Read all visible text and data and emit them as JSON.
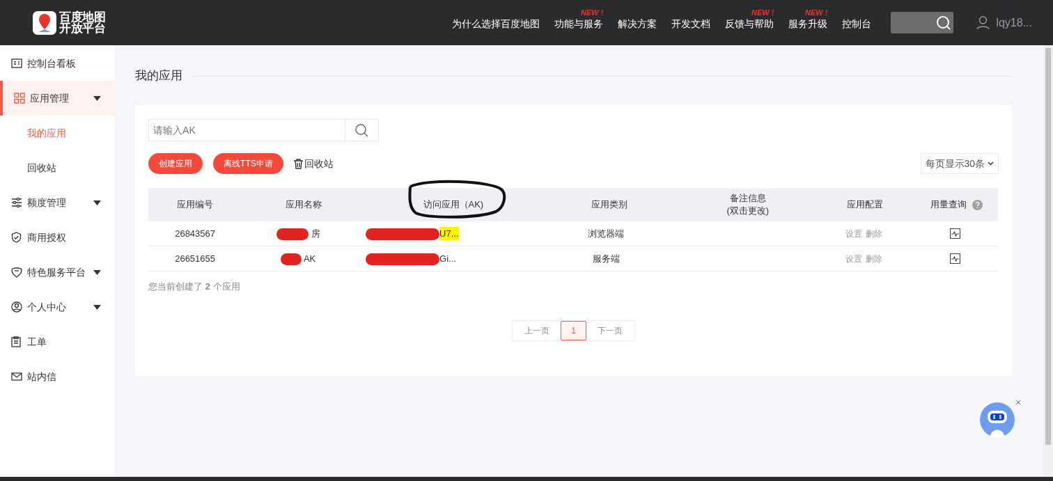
{
  "header": {
    "logo_text": [
      "百度地图",
      "开放平台"
    ],
    "nav": [
      {
        "label": "为什么选择百度地图"
      },
      {
        "label": "功能与服务",
        "badge": "NEW !"
      },
      {
        "label": "解决方案"
      },
      {
        "label": "开发文档"
      },
      {
        "label": "反馈与帮助",
        "badge": "NEW !"
      },
      {
        "label": "服务升级",
        "badge": "NEW !"
      },
      {
        "label": "控制台"
      }
    ],
    "user": "lqy18..."
  },
  "sidebar": {
    "items": [
      {
        "label": "控制台看板",
        "selected": false,
        "expandable": false
      },
      {
        "label": "应用管理",
        "selected": true,
        "expandable": true,
        "children": [
          {
            "label": "我的应用",
            "selected": true
          },
          {
            "label": "回收站",
            "selected": false
          }
        ]
      },
      {
        "label": "额度管理",
        "selected": false,
        "expandable": true
      },
      {
        "label": "商用授权",
        "selected": false,
        "expandable": false
      },
      {
        "label": "特色服务平台",
        "selected": false,
        "expandable": true
      },
      {
        "label": "个人中心",
        "selected": false,
        "expandable": true
      },
      {
        "label": "工单",
        "selected": false,
        "expandable": false
      },
      {
        "label": "站内信",
        "selected": false,
        "expandable": false
      }
    ]
  },
  "page_title": "我的应用",
  "search": {
    "placeholder": "请输入AK"
  },
  "buttons": [
    "创建应用",
    "离线TTS申请"
  ],
  "recycle_link": "回收站",
  "page_size": "每页显示30条",
  "table": {
    "columns": [
      "应用编号",
      "应用名称",
      "访问应用（AK)",
      "应用类别",
      "备注信息\n(双击更改)",
      "应用配置",
      "用量查询"
    ],
    "rows": [
      {
        "id": "26843567",
        "name": "房",
        "ak": "U7...",
        "ak_highlighted": true,
        "category": "浏览器端",
        "actions": [
          "设置",
          "删除"
        ]
      },
      {
        "id": "26651655",
        "name": "AK",
        "ak": "Gi...",
        "ak_highlighted": false,
        "category": "服务端",
        "actions": [
          "设置",
          "删除"
        ]
      }
    ]
  },
  "summary": "您当前创建了 **2** 个应用",
  "pagination": {
    "prev": "上一页",
    "next": "下一页",
    "pages": [
      {
        "label": "1",
        "selected": true
      }
    ]
  },
  "float_close": "×"
}
